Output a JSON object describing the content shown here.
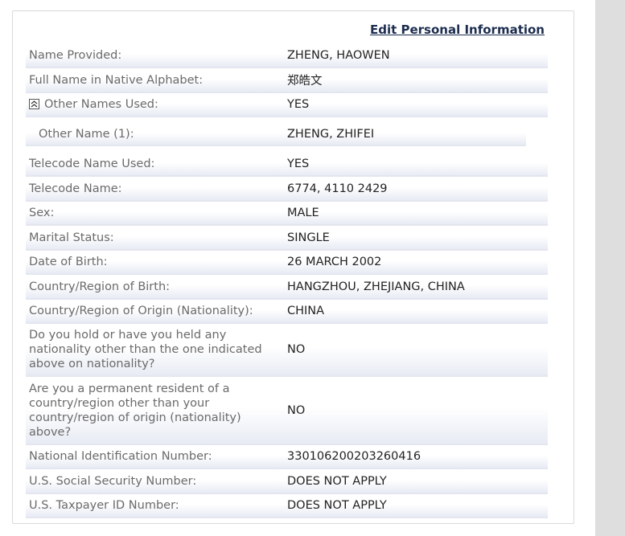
{
  "edit_link": "Edit Personal Information",
  "rows": [
    {
      "label": "Name Provided:",
      "value": "ZHENG, HAOWEN"
    },
    {
      "label": "Full Name in Native Alphabet:",
      "value": "郑皓文"
    },
    {
      "label": "Other Names Used:",
      "value": "YES"
    },
    {
      "label": "Other Name (1):",
      "value": "ZHENG, ZHIFEI"
    },
    {
      "label": "Telecode Name Used:",
      "value": "YES"
    },
    {
      "label": "Telecode Name:",
      "value": "6774, 4110 2429"
    },
    {
      "label": "Sex:",
      "value": "MALE"
    },
    {
      "label": "Marital Status:",
      "value": "SINGLE"
    },
    {
      "label": "Date of Birth:",
      "value": "26 MARCH 2002"
    },
    {
      "label": "Country/Region of Birth:",
      "value": "HANGZHOU, ZHEJIANG, CHINA"
    },
    {
      "label": "Country/Region of Origin (Nationality):",
      "value": "CHINA"
    },
    {
      "label": "Do you hold or have you held any nationality other than the one indicated above on nationality?",
      "value": "NO"
    },
    {
      "label": "Are you a permanent resident of a country/region other than your country/region of origin (nationality) above?",
      "value": "NO"
    },
    {
      "label": "National Identification Number:",
      "value": "330106200203260416"
    },
    {
      "label": "U.S. Social Security Number:",
      "value": "DOES NOT APPLY"
    },
    {
      "label": "U.S. Taxpayer ID Number:",
      "value": "DOES NOT APPLY"
    }
  ]
}
